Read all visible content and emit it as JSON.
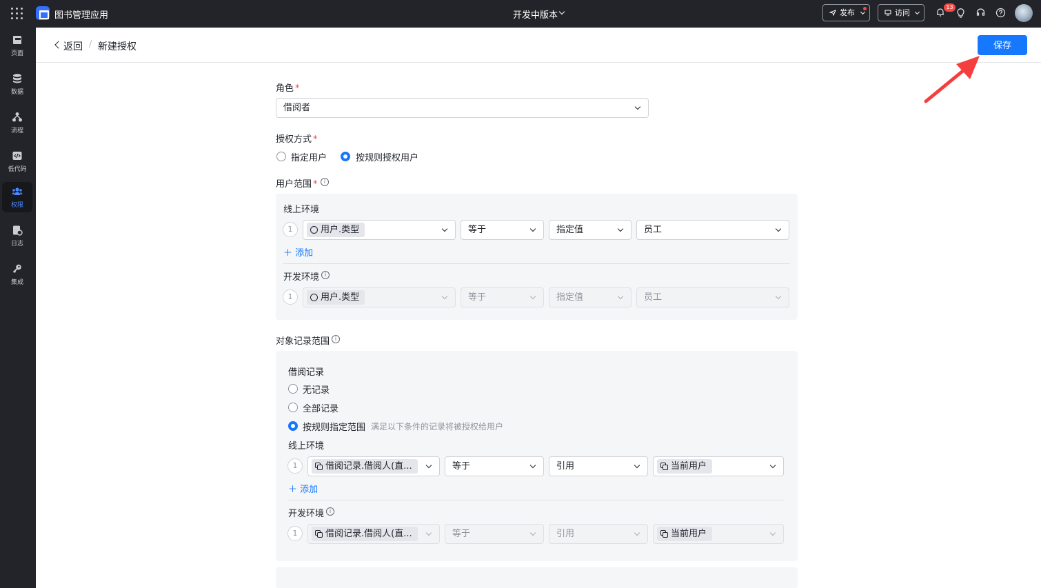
{
  "topbar": {
    "app_name": "图书管理应用",
    "version": "开发中版本",
    "publish_label": "发布",
    "visit_label": "访问",
    "notification_count": "13"
  },
  "sidebar": {
    "items": [
      {
        "label": "页面",
        "icon": "page-icon"
      },
      {
        "label": "数据",
        "icon": "database-icon"
      },
      {
        "label": "流程",
        "icon": "flow-icon"
      },
      {
        "label": "低代码",
        "icon": "code-icon"
      },
      {
        "label": "权限",
        "icon": "users-icon",
        "active": true
      },
      {
        "label": "日志",
        "icon": "log-icon"
      },
      {
        "label": "集成",
        "icon": "key-icon"
      }
    ]
  },
  "header": {
    "back_label": "返回",
    "separator": "/",
    "title": "新建授权",
    "save_label": "保存"
  },
  "form": {
    "role": {
      "label": "角色",
      "value": "借阅者"
    },
    "auth_method": {
      "label": "授权方式",
      "options": [
        "指定用户",
        "按规则授权用户"
      ],
      "selected": "按规则授权用户"
    },
    "user_scope": {
      "label": "用户范围",
      "online": {
        "label": "线上环境",
        "index": "1",
        "field": "用户.类型",
        "operator": "等于",
        "value_type": "指定值",
        "value": "员工",
        "add_label": "添加"
      },
      "dev": {
        "label": "开发环境",
        "index": "1",
        "field": "用户.类型",
        "operator": "等于",
        "value_type": "指定值",
        "value": "员工"
      }
    },
    "record_scope": {
      "label": "对象记录范围",
      "object_label": "借阅记录",
      "options": [
        "无记录",
        "全部记录",
        "按规则指定范围"
      ],
      "selected": "按规则指定范围",
      "rule_hint": "满足以下条件的记录将被授权给用户",
      "online": {
        "label": "线上环境",
        "index": "1",
        "field": "借阅记录.借阅人(直...",
        "operator": "等于",
        "value_type": "引用",
        "value": "当前用户",
        "add_label": "添加"
      },
      "dev": {
        "label": "开发环境",
        "index": "1",
        "field": "借阅记录.借阅人(直...",
        "operator": "等于",
        "value_type": "引用",
        "value": "当前用户"
      }
    }
  },
  "colors": {
    "accent": "#1677ff",
    "topbar": "#232429",
    "danger": "#f54a45",
    "annotation": "#f53f3f"
  }
}
